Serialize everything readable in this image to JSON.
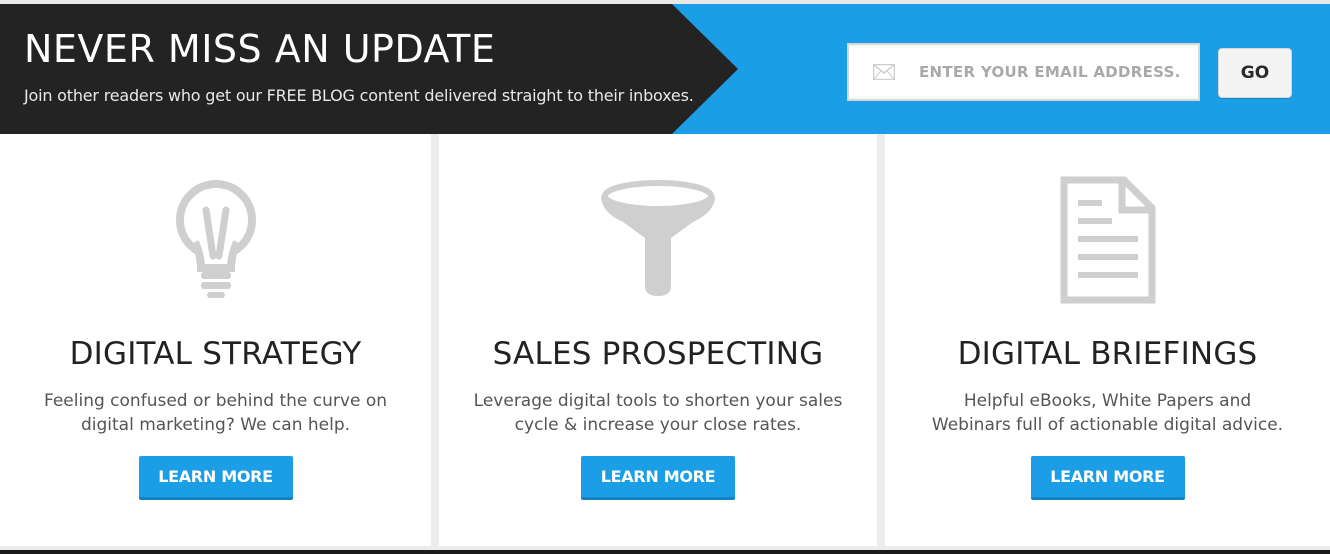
{
  "signup": {
    "title": "NEVER MISS AN UPDATE",
    "subtitle": "Join other readers who get our FREE BLOG content delivered straight to their inboxes.",
    "email_placeholder": "ENTER YOUR EMAIL ADDRESS...",
    "email_value": "",
    "go_label": "GO",
    "icon": "envelope-icon"
  },
  "services": [
    {
      "icon": "lightbulb-icon",
      "title": "DIGITAL STRATEGY",
      "desc_line1": "Feeling confused or behind the curve on",
      "desc_line2": "digital marketing? We can help.",
      "button": "LEARN MORE"
    },
    {
      "icon": "funnel-icon",
      "title": "SALES PROSPECTING",
      "desc_line1": "Leverage digital tools to shorten your sales",
      "desc_line2": "cycle & increase your close rates.",
      "button": "LEARN MORE"
    },
    {
      "icon": "document-icon",
      "title": "DIGITAL BRIEFINGS",
      "desc_line1": "Helpful eBooks, White Papers and",
      "desc_line2": "Webinars full of actionable digital advice.",
      "button": "LEARN MORE"
    }
  ],
  "colors": {
    "accent": "#1b9ee6",
    "dark": "#232323",
    "icon_gray": "#cfcfcf"
  }
}
